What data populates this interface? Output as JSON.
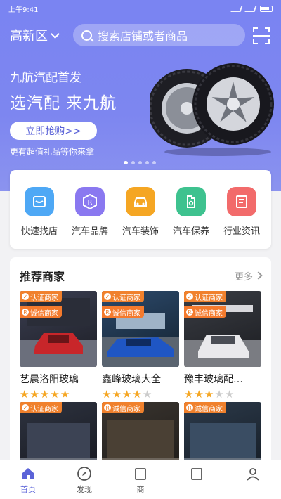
{
  "status": {
    "time": "上午9:41"
  },
  "header": {
    "city": "高新区",
    "search_placeholder": "搜索店铺或者商品"
  },
  "banner": {
    "subtitle": "九航汽配首发",
    "title": "选汽配 来九航",
    "button": "立即抢购>>",
    "note": "更有超值礼品等你来拿"
  },
  "categories": [
    {
      "label": "快速找店",
      "color": "#4ea8f5",
      "icon": "shop-icon"
    },
    {
      "label": "汽车品牌",
      "color": "#8a78f0",
      "icon": "brand-icon"
    },
    {
      "label": "汽车装饰",
      "color": "#f5a623",
      "icon": "car-icon"
    },
    {
      "label": "汽车保养",
      "color": "#3ec28f",
      "icon": "oil-icon"
    },
    {
      "label": "行业资讯",
      "color": "#f26b6b",
      "icon": "news-icon"
    }
  ],
  "recommend": {
    "title": "推荐商家",
    "more": "更多",
    "badge_cert": "认证商家",
    "badge_trust": "诚信商家",
    "shops": [
      {
        "name": "艺晨洛阳玻璃",
        "rating": 5
      },
      {
        "name": "鑫峰玻璃大全",
        "rating": 4
      },
      {
        "name": "豫丰玻璃配…",
        "rating": 3
      }
    ]
  },
  "tabs": [
    {
      "label": "首页"
    },
    {
      "label": "发现"
    },
    {
      "label": "商"
    },
    {
      "label": ""
    },
    {
      "label": ""
    }
  ],
  "colors": {
    "accent": "#5b63d8",
    "header": "#7a84f2",
    "star": "#f5a623"
  }
}
